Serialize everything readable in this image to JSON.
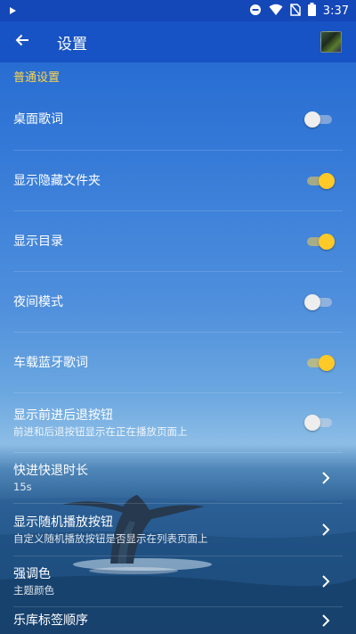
{
  "status_bar": {
    "time": "3:37",
    "icons": [
      "play-icon",
      "do-not-disturb-icon",
      "wifi-icon",
      "no-sim-icon",
      "battery-icon"
    ]
  },
  "app_bar": {
    "title": "设置",
    "back_icon": "arrow-left-icon"
  },
  "section": {
    "header": "普通设置"
  },
  "settings": [
    {
      "title": "桌面歌词",
      "subtitle": "",
      "type": "switch",
      "checked": false
    },
    {
      "title": "显示隐藏文件夹",
      "subtitle": "",
      "type": "switch",
      "checked": true
    },
    {
      "title": "显示目录",
      "subtitle": "",
      "type": "switch",
      "checked": true
    },
    {
      "title": "夜间模式",
      "subtitle": "",
      "type": "switch",
      "checked": false
    },
    {
      "title": "车载蓝牙歌词",
      "subtitle": "",
      "type": "switch",
      "checked": true
    },
    {
      "title": "显示前进后退按钮",
      "subtitle": "前进和后退按钮显示在正在播放页面上",
      "type": "switch",
      "checked": false
    },
    {
      "title": "快进快退时长",
      "subtitle": "15s",
      "type": "nav"
    },
    {
      "title": "显示随机播放按钮",
      "subtitle": "自定义随机播放按钮是否显示在列表页面上",
      "type": "nav"
    },
    {
      "title": "强调色",
      "subtitle": "主题颜色",
      "type": "nav"
    },
    {
      "title": "乐库标签顺序",
      "subtitle": "",
      "type": "nav"
    }
  ],
  "colors": {
    "status_bar": "#1447b8",
    "app_bar": "#1753c4",
    "accent": "#ffc928",
    "section_header": "#ffd54a"
  }
}
